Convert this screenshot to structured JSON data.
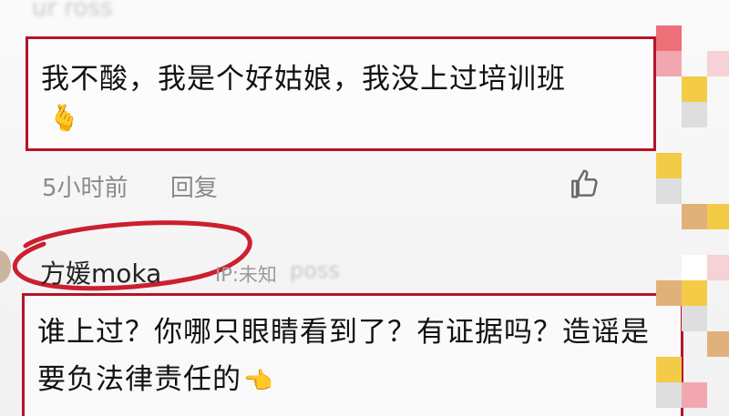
{
  "comment_1": {
    "header_blur": "ur ross",
    "text": "我不酸，我是个好姑娘，我没上过培训班",
    "emoji": "🫰",
    "time": "5小时前",
    "reply_label": "回复"
  },
  "comment_2": {
    "username": "方媛moka",
    "ip": "IP:未知",
    "mention_blur": "poss",
    "text": "谁上过？你哪只眼睛看到了？有证据吗？造谣是要负法律责任的",
    "emoji": "👈"
  },
  "colors": {
    "highlight": "#b3152b",
    "mosaic": [
      "#f6d1d6",
      "#e0b27a",
      "#f4cb47",
      "#ed6f77",
      "#e7808b",
      "#dedede",
      "#f2a7b0",
      "#ffffff"
    ]
  },
  "icons": [
    "thumbs-up-icon",
    "heart-hand-emoji",
    "pointing-hand-emoji"
  ]
}
